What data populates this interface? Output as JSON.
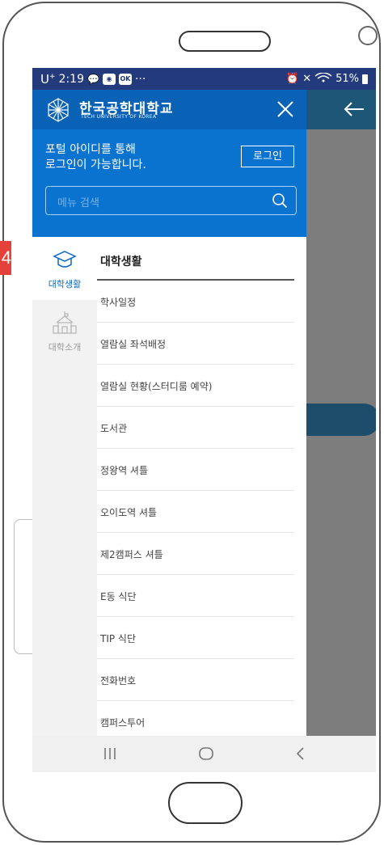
{
  "status_bar": {
    "carrier": "U",
    "carrier_sup": "+",
    "time": "2:19",
    "dots": "···",
    "icons_right": "⏰ ✕",
    "signal": "51%"
  },
  "drawer": {
    "logo_title": "한국공학대학교",
    "logo_sub": "TECH UNIVERSITY OF KOREA",
    "login_line1": "포털 아이디를 통해",
    "login_line2": "로그인이 가능합니다.",
    "login_button": "로그인",
    "search_placeholder": "메뉴 검색"
  },
  "rail": {
    "items": [
      {
        "label": "대학생활",
        "icon": "graduation-cap-icon",
        "active": true
      },
      {
        "label": "대학소개",
        "icon": "school-building-icon",
        "active": false
      }
    ]
  },
  "menu": {
    "heading": "대학생활",
    "items": [
      "학사일정",
      "열람실 좌석배정",
      "열람실 현황(스터디룸 예약)",
      "도서관",
      "정왕역 셔틀",
      "오이도역 셔틀",
      "제2캠퍼스 셔틀",
      "E동 식단",
      "TIP 식단",
      "전화번호",
      "캠퍼스투어"
    ]
  },
  "badge": {
    "text": "4"
  },
  "colors": {
    "drawer_blue": "#0a73cf",
    "header_blue": "#0a62b7",
    "status_bar": "#233a7c",
    "accent_active": "#0a67c1"
  }
}
